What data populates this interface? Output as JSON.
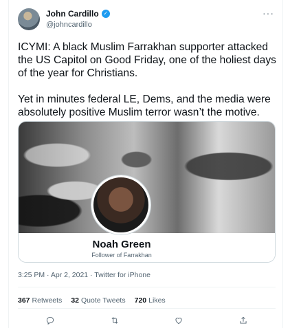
{
  "author": {
    "name": "John Cardillo",
    "handle": "@johncardillo",
    "verified_icon": "✓"
  },
  "more_icon": "···",
  "tweet": {
    "paragraph1": "ICYMI: A black Muslim Farrakhan supporter attacked the US Capitol on Good Friday, one of the holiest days of the year for Christians.",
    "paragraph2": "Yet in minutes federal LE, Dems, and the media were absolutely positive Muslim terror wasn’t the motive."
  },
  "card": {
    "title": "Noah Green",
    "subtitle": "Follower of Farrakhan"
  },
  "meta": {
    "timestamp": "3:25 PM · Apr 2, 2021 · Twitter for iPhone"
  },
  "stats": {
    "retweets_count": "367",
    "retweets_label": "Retweets",
    "quotes_count": "32",
    "quotes_label": "Quote Tweets",
    "likes_count": "720",
    "likes_label": "Likes"
  },
  "actions": [
    "reply-icon",
    "retweet-icon",
    "like-icon",
    "share-icon"
  ],
  "colors": {
    "accent": "#1d9bf0",
    "secondary_text": "#536471",
    "primary_text": "#0f1419"
  }
}
